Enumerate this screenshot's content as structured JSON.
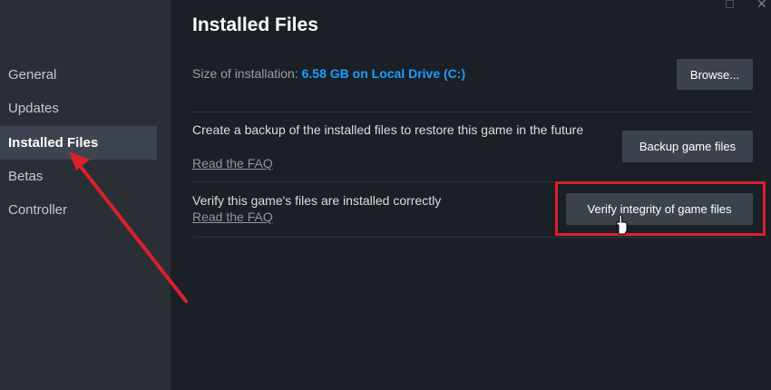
{
  "sidebar": {
    "items": [
      {
        "label": "General",
        "active": false
      },
      {
        "label": "Updates",
        "active": false
      },
      {
        "label": "Installed Files",
        "active": true
      },
      {
        "label": "Betas",
        "active": false
      },
      {
        "label": "Controller",
        "active": false
      }
    ]
  },
  "window_controls": {
    "maximize_icon": "□",
    "close_icon": "✕"
  },
  "main": {
    "title": "Installed Files",
    "size_label": "Size of installation:",
    "size_value": "6.58 GB on Local Drive (C:)",
    "browse_label": "Browse...",
    "backup_desc": "Create a backup of the installed files to restore this game in the future",
    "backup_faq": "Read the FAQ",
    "backup_button": "Backup game files",
    "verify_desc": "Verify this game's files are installed correctly",
    "verify_faq": "Read the FAQ",
    "verify_button": "Verify integrity of game files"
  },
  "annotations": {
    "highlight_color": "#d8212b",
    "arrow_color": "#d8212b"
  },
  "colors": {
    "accent": "#1a9fff",
    "background": "#1b1f26",
    "sidebar": "#2a2e35"
  }
}
